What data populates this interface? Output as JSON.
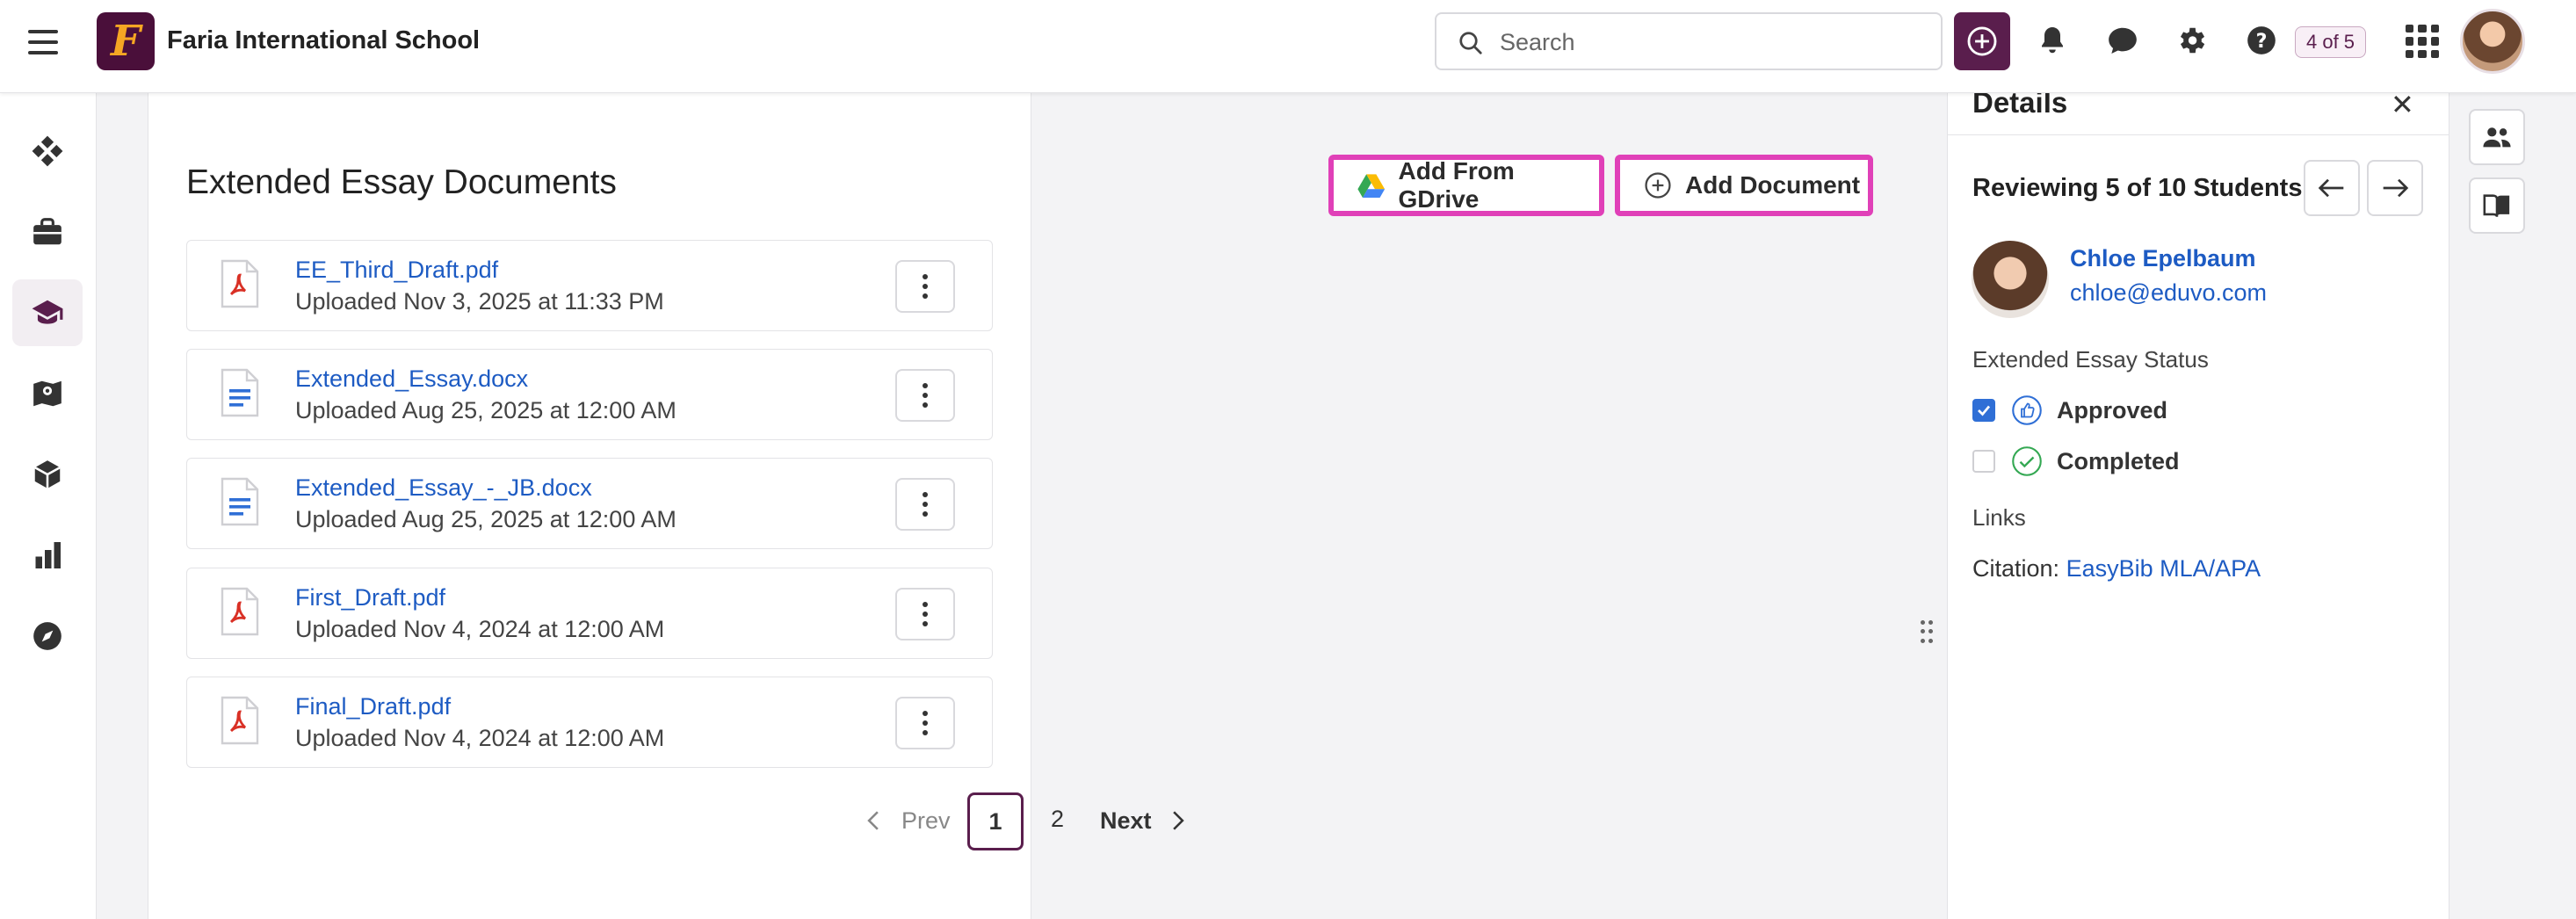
{
  "header": {
    "school_name": "Faria International School",
    "logo_letter": "F",
    "search_placeholder": "Search",
    "counter": "4 of 5"
  },
  "left_rail": {
    "items": [
      {
        "icon": "diamond-grid-icon"
      },
      {
        "icon": "briefcase-icon"
      },
      {
        "icon": "graduation-cap-icon",
        "active": true
      },
      {
        "icon": "map-pin-book-icon"
      },
      {
        "icon": "cube-icon"
      },
      {
        "icon": "bar-chart-icon"
      },
      {
        "icon": "compass-icon"
      }
    ]
  },
  "main": {
    "title": "Extended Essay Documents",
    "add_gdrive_label": "Add From GDrive",
    "add_document_label": "Add Document",
    "documents": [
      {
        "name": "EE_Third_Draft.pdf",
        "uploaded": "Uploaded Nov 3, 2025 at 11:33 PM",
        "type": "pdf"
      },
      {
        "name": "Extended_Essay.docx",
        "uploaded": "Uploaded Aug 25, 2025 at 12:00 AM",
        "type": "doc"
      },
      {
        "name": "Extended_Essay_-_JB.docx",
        "uploaded": "Uploaded Aug 25, 2025 at 12:00 AM",
        "type": "doc"
      },
      {
        "name": "First_Draft.pdf",
        "uploaded": "Uploaded Nov 4, 2024 at 12:00 AM",
        "type": "pdf"
      },
      {
        "name": "Final_Draft.pdf",
        "uploaded": "Uploaded Nov 4, 2024 at 12:00 AM",
        "type": "pdf"
      }
    ],
    "pagination": {
      "prev": "Prev",
      "current": "1",
      "next_page": "2",
      "next": "Next"
    }
  },
  "details": {
    "title": "Details",
    "reviewing": "Reviewing 5 of 10 Students",
    "student_name": "Chloe Epelbaum",
    "student_email": "chloe@eduvo.com",
    "status_heading": "Extended Essay Status",
    "approved_label": "Approved",
    "completed_label": "Completed",
    "links_heading": "Links",
    "citation_prefix": "Citation:",
    "citation_link": "EasyBib MLA/APA"
  },
  "colors": {
    "brand": "#5a1e4d",
    "highlight": "#e040b8",
    "link": "#1d5bc3",
    "pdf_red": "#d93025",
    "doc_blue": "#2f6fd6",
    "check_green": "#34a853"
  }
}
